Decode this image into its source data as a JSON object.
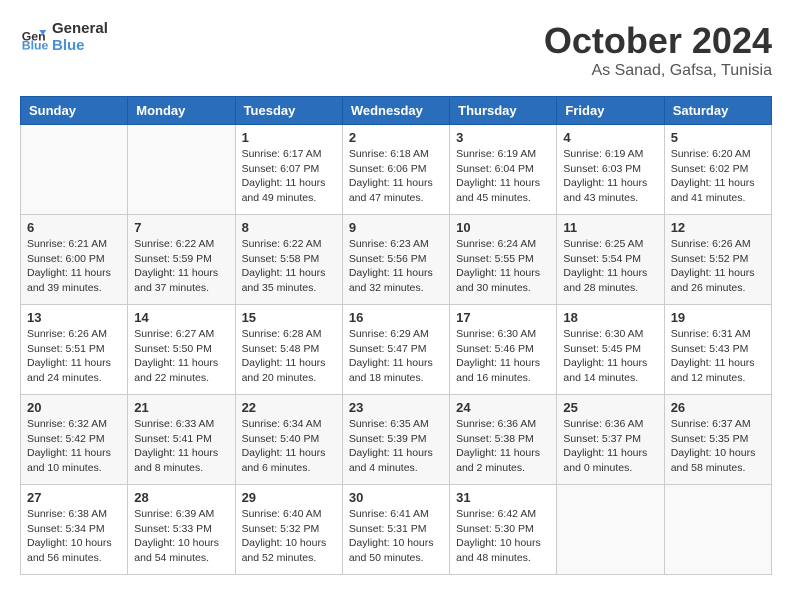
{
  "header": {
    "logo_line1": "General",
    "logo_line2": "Blue",
    "month": "October 2024",
    "location": "As Sanad, Gafsa, Tunisia"
  },
  "weekdays": [
    "Sunday",
    "Monday",
    "Tuesday",
    "Wednesday",
    "Thursday",
    "Friday",
    "Saturday"
  ],
  "weeks": [
    [
      {
        "day": "",
        "info": ""
      },
      {
        "day": "",
        "info": ""
      },
      {
        "day": "1",
        "info": "Sunrise: 6:17 AM\nSunset: 6:07 PM\nDaylight: 11 hours and 49 minutes."
      },
      {
        "day": "2",
        "info": "Sunrise: 6:18 AM\nSunset: 6:06 PM\nDaylight: 11 hours and 47 minutes."
      },
      {
        "day": "3",
        "info": "Sunrise: 6:19 AM\nSunset: 6:04 PM\nDaylight: 11 hours and 45 minutes."
      },
      {
        "day": "4",
        "info": "Sunrise: 6:19 AM\nSunset: 6:03 PM\nDaylight: 11 hours and 43 minutes."
      },
      {
        "day": "5",
        "info": "Sunrise: 6:20 AM\nSunset: 6:02 PM\nDaylight: 11 hours and 41 minutes."
      }
    ],
    [
      {
        "day": "6",
        "info": "Sunrise: 6:21 AM\nSunset: 6:00 PM\nDaylight: 11 hours and 39 minutes."
      },
      {
        "day": "7",
        "info": "Sunrise: 6:22 AM\nSunset: 5:59 PM\nDaylight: 11 hours and 37 minutes."
      },
      {
        "day": "8",
        "info": "Sunrise: 6:22 AM\nSunset: 5:58 PM\nDaylight: 11 hours and 35 minutes."
      },
      {
        "day": "9",
        "info": "Sunrise: 6:23 AM\nSunset: 5:56 PM\nDaylight: 11 hours and 32 minutes."
      },
      {
        "day": "10",
        "info": "Sunrise: 6:24 AM\nSunset: 5:55 PM\nDaylight: 11 hours and 30 minutes."
      },
      {
        "day": "11",
        "info": "Sunrise: 6:25 AM\nSunset: 5:54 PM\nDaylight: 11 hours and 28 minutes."
      },
      {
        "day": "12",
        "info": "Sunrise: 6:26 AM\nSunset: 5:52 PM\nDaylight: 11 hours and 26 minutes."
      }
    ],
    [
      {
        "day": "13",
        "info": "Sunrise: 6:26 AM\nSunset: 5:51 PM\nDaylight: 11 hours and 24 minutes."
      },
      {
        "day": "14",
        "info": "Sunrise: 6:27 AM\nSunset: 5:50 PM\nDaylight: 11 hours and 22 minutes."
      },
      {
        "day": "15",
        "info": "Sunrise: 6:28 AM\nSunset: 5:48 PM\nDaylight: 11 hours and 20 minutes."
      },
      {
        "day": "16",
        "info": "Sunrise: 6:29 AM\nSunset: 5:47 PM\nDaylight: 11 hours and 18 minutes."
      },
      {
        "day": "17",
        "info": "Sunrise: 6:30 AM\nSunset: 5:46 PM\nDaylight: 11 hours and 16 minutes."
      },
      {
        "day": "18",
        "info": "Sunrise: 6:30 AM\nSunset: 5:45 PM\nDaylight: 11 hours and 14 minutes."
      },
      {
        "day": "19",
        "info": "Sunrise: 6:31 AM\nSunset: 5:43 PM\nDaylight: 11 hours and 12 minutes."
      }
    ],
    [
      {
        "day": "20",
        "info": "Sunrise: 6:32 AM\nSunset: 5:42 PM\nDaylight: 11 hours and 10 minutes."
      },
      {
        "day": "21",
        "info": "Sunrise: 6:33 AM\nSunset: 5:41 PM\nDaylight: 11 hours and 8 minutes."
      },
      {
        "day": "22",
        "info": "Sunrise: 6:34 AM\nSunset: 5:40 PM\nDaylight: 11 hours and 6 minutes."
      },
      {
        "day": "23",
        "info": "Sunrise: 6:35 AM\nSunset: 5:39 PM\nDaylight: 11 hours and 4 minutes."
      },
      {
        "day": "24",
        "info": "Sunrise: 6:36 AM\nSunset: 5:38 PM\nDaylight: 11 hours and 2 minutes."
      },
      {
        "day": "25",
        "info": "Sunrise: 6:36 AM\nSunset: 5:37 PM\nDaylight: 11 hours and 0 minutes."
      },
      {
        "day": "26",
        "info": "Sunrise: 6:37 AM\nSunset: 5:35 PM\nDaylight: 10 hours and 58 minutes."
      }
    ],
    [
      {
        "day": "27",
        "info": "Sunrise: 6:38 AM\nSunset: 5:34 PM\nDaylight: 10 hours and 56 minutes."
      },
      {
        "day": "28",
        "info": "Sunrise: 6:39 AM\nSunset: 5:33 PM\nDaylight: 10 hours and 54 minutes."
      },
      {
        "day": "29",
        "info": "Sunrise: 6:40 AM\nSunset: 5:32 PM\nDaylight: 10 hours and 52 minutes."
      },
      {
        "day": "30",
        "info": "Sunrise: 6:41 AM\nSunset: 5:31 PM\nDaylight: 10 hours and 50 minutes."
      },
      {
        "day": "31",
        "info": "Sunrise: 6:42 AM\nSunset: 5:30 PM\nDaylight: 10 hours and 48 minutes."
      },
      {
        "day": "",
        "info": ""
      },
      {
        "day": "",
        "info": ""
      }
    ]
  ]
}
